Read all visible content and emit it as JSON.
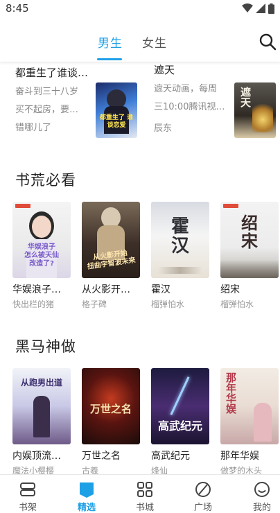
{
  "status": {
    "time": "8:45"
  },
  "top_tabs": [
    {
      "label": "男生",
      "active": true
    },
    {
      "label": "女生",
      "active": false
    }
  ],
  "recommend": [
    {
      "title": "都重生了谁谈…",
      "desc_lines": [
        "奋斗到三十八岁",
        "买不起房，要…",
        "错哪儿了"
      ],
      "cover_text": "都重生了 谁谈恋爱"
    },
    {
      "title": "遮天",
      "desc_lines": [
        "遮天动画，每周",
        "三10:00腾讯视…"
      ],
      "author": "辰东",
      "cover_text": "遮天"
    }
  ],
  "sections": [
    {
      "title": "书荒必看",
      "books": [
        {
          "title": "华娱浪子…",
          "author": "快出栏的猪",
          "cover_text": "华娱浪子 怎么被天仙 改造了?"
        },
        {
          "title": "从火影开…",
          "author": "格子碑",
          "cover_text": "从火影开始 扭曲宇智波未来"
        },
        {
          "title": "霍汉",
          "author": "榴弹怕水",
          "cover_text": "霍汉"
        },
        {
          "title": "绍宋",
          "author": "榴弹怕水",
          "cover_text": "绍宋"
        }
      ]
    },
    {
      "title": "黑马神做",
      "books": [
        {
          "title": "内娱顶流…",
          "author": "魔法小樱樱",
          "cover_text": "从跑男出道"
        },
        {
          "title": "万世之名",
          "author": "古羲",
          "cover_text": "万世之名"
        },
        {
          "title": "高武纪元",
          "author": "烽仙",
          "cover_text": "高武纪元"
        },
        {
          "title": "那年华娱",
          "author": "做梦的木头",
          "cover_text": "那年华娱"
        }
      ]
    }
  ],
  "bottom_nav": [
    {
      "label": "书架",
      "icon": "bookshelf-icon",
      "active": false
    },
    {
      "label": "精选",
      "icon": "featured-icon",
      "active": true
    },
    {
      "label": "书城",
      "icon": "grid-icon",
      "active": false
    },
    {
      "label": "广场",
      "icon": "leaf-icon",
      "active": false
    },
    {
      "label": "我的",
      "icon": "smile-icon",
      "active": false
    }
  ],
  "colors": {
    "accent": "#1ea0e6",
    "text": "#222222",
    "muted": "#888888"
  }
}
